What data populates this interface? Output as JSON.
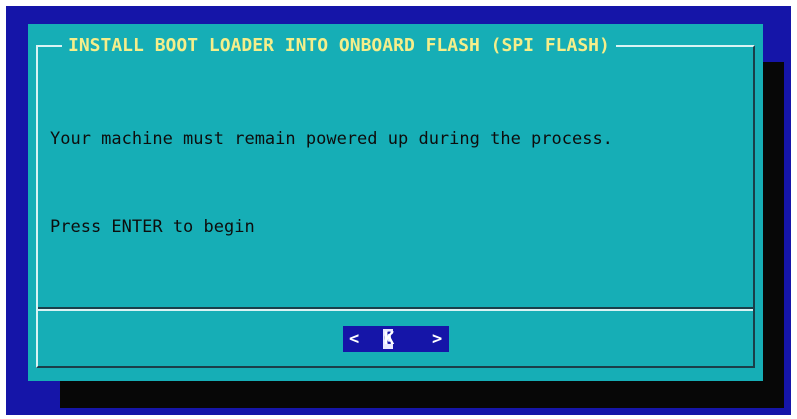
{
  "dialog": {
    "title": "INSTALL BOOT LOADER INTO ONBOARD FLASH (SPI FLASH)",
    "message_line1": "Your machine must remain powered up during the process.",
    "message_line2": "Press ENTER to begin"
  },
  "buttons": {
    "ok": {
      "left_bracket": "<",
      "hotkey": "O",
      "rest": "K",
      "right_bracket": ">"
    }
  },
  "colors": {
    "screen_background": "#1515a8",
    "dialog_background": "#16aeb6",
    "title_text": "#f5ee8a",
    "body_text": "#0d0d0d",
    "shadow": "#070707",
    "button_background": "#1515a8",
    "button_text": "#ffffff"
  }
}
